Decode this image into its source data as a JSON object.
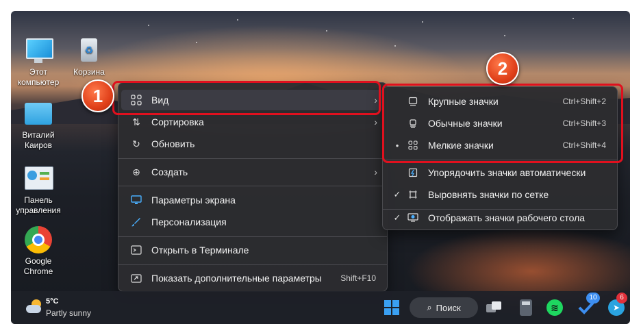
{
  "desktop": {
    "icons": [
      {
        "label_line1": "Этот",
        "label_line2": "компьютер",
        "icon": "this-pc-icon"
      },
      {
        "label_line1": "Корзина",
        "label_line2": "",
        "icon": "recycle-bin-icon"
      },
      {
        "label_line1": "Виталий",
        "label_line2": "Каиров",
        "icon": "user-folder-icon"
      },
      {
        "label_line1": "Панель",
        "label_line2": "управления",
        "icon": "control-panel-icon"
      },
      {
        "label_line1": "Google",
        "label_line2": "Chrome",
        "icon": "chrome-icon"
      }
    ]
  },
  "context_menu": {
    "items": [
      {
        "label": "Вид",
        "icon": "grid-icon",
        "submenu": true
      },
      {
        "label": "Сортировка",
        "icon": "sort-icon",
        "submenu": true
      },
      {
        "label": "Обновить",
        "icon": "refresh-icon",
        "submenu": false
      },
      {
        "label": "Создать",
        "icon": "plus-circle-icon",
        "submenu": true
      },
      {
        "label": "Параметры экрана",
        "icon": "display-icon",
        "submenu": false
      },
      {
        "label": "Персонализация",
        "icon": "brush-icon",
        "submenu": false
      },
      {
        "label": "Открыть в Терминале",
        "icon": "terminal-icon",
        "submenu": false
      },
      {
        "label": "Показать дополнительные параметры",
        "icon": "share-icon",
        "shortcut": "Shift+F10",
        "submenu": false
      }
    ]
  },
  "view_submenu": {
    "items": [
      {
        "label": "Крупные значки",
        "shortcut": "Ctrl+Shift+2",
        "icon": "large-icons-icon",
        "mark": ""
      },
      {
        "label": "Обычные значки",
        "shortcut": "Ctrl+Shift+3",
        "icon": "medium-icons-icon",
        "mark": ""
      },
      {
        "label": "Мелкие значки",
        "shortcut": "Ctrl+Shift+4",
        "icon": "small-icons-icon",
        "mark": "•"
      },
      {
        "label": "Упорядочить значки автоматически",
        "shortcut": "",
        "icon": "auto-arrange-icon",
        "mark": ""
      },
      {
        "label": "Выровнять значки по сетке",
        "shortcut": "",
        "icon": "align-grid-icon",
        "mark": "✓"
      },
      {
        "label": "Отображать значки рабочего стола",
        "shortcut": "",
        "icon": "show-desktop-icons-icon",
        "mark": "✓"
      }
    ]
  },
  "badges": {
    "one": "1",
    "two": "2"
  },
  "taskbar": {
    "weather_temp": "5°C",
    "weather_desc": "Partly sunny",
    "search_label": "Поиск",
    "steam_badge": "10",
    "telegram_badge": "6"
  },
  "colors": {
    "highlight": "#e0101e",
    "badge": "#e8501e"
  }
}
